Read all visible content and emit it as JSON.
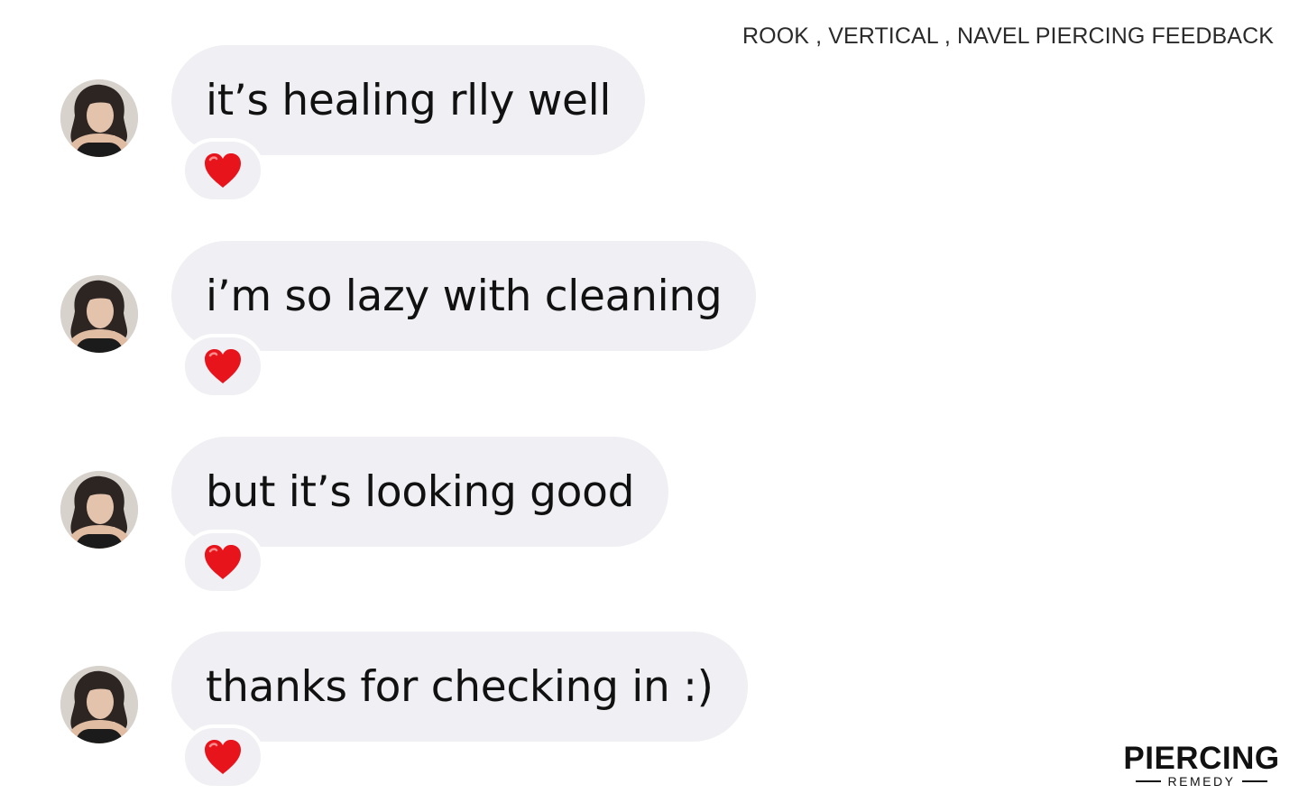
{
  "header": {
    "caption": "ROOK , VERTICAL , NAVEL PIERCING FEEDBACK"
  },
  "messages": [
    {
      "text": "it’s healing rlly well",
      "reaction": "red-heart"
    },
    {
      "text": "i’m so lazy with cleaning",
      "reaction": "red-heart"
    },
    {
      "text": "but it’s looking good",
      "reaction": "red-heart"
    },
    {
      "text": "thanks for checking in :)",
      "reaction": "red-heart"
    }
  ],
  "brand": {
    "name": "PIERCING",
    "subtitle": "REMEDY"
  },
  "colors": {
    "bubble": "#efeff4",
    "heart": "#e8141c",
    "background": "#ffffff"
  }
}
